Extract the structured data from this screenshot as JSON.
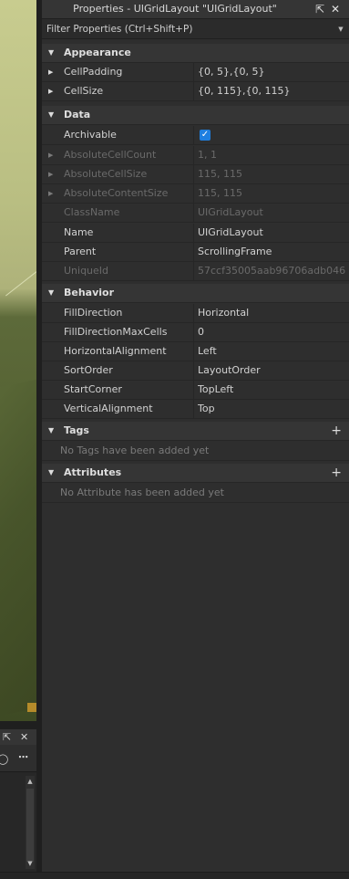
{
  "panel": {
    "title": "Properties - UIGridLayout \"UIGridLayout\"",
    "filter_placeholder": "Filter Properties (Ctrl+Shift+P)"
  },
  "sections": {
    "appearance": "Appearance",
    "data": "Data",
    "behavior": "Behavior",
    "tags": "Tags",
    "attributes": "Attributes"
  },
  "appearance": [
    {
      "name": "CellPadding",
      "value": "{0, 5},{0, 5}"
    },
    {
      "name": "CellSize",
      "value": "{0, 115},{0, 115}"
    }
  ],
  "data": {
    "archivable": {
      "name": "Archivable",
      "checked": true
    },
    "absolute_cell_count": {
      "name": "AbsoluteCellCount",
      "value": "1, 1"
    },
    "absolute_cell_size": {
      "name": "AbsoluteCellSize",
      "value": "115, 115"
    },
    "absolute_content_size": {
      "name": "AbsoluteContentSize",
      "value": "115, 115"
    },
    "class_name": {
      "name": "ClassName",
      "value": "UIGridLayout"
    },
    "name": {
      "name": "Name",
      "value": "UIGridLayout"
    },
    "parent": {
      "name": "Parent",
      "value": "ScrollingFrame"
    },
    "unique_id": {
      "name": "UniqueId",
      "value": "57ccf35005aab96706adb046..."
    }
  },
  "behavior": [
    {
      "name": "FillDirection",
      "value": "Horizontal"
    },
    {
      "name": "FillDirectionMaxCells",
      "value": "0"
    },
    {
      "name": "HorizontalAlignment",
      "value": "Left"
    },
    {
      "name": "SortOrder",
      "value": "LayoutOrder"
    },
    {
      "name": "StartCorner",
      "value": "TopLeft"
    },
    {
      "name": "VerticalAlignment",
      "value": "Top"
    }
  ],
  "tags_empty": "No Tags have been added yet",
  "attributes_empty": "No Attribute has been added yet",
  "colors": {
    "panel_bg": "#2e2e2e",
    "header_bg": "#353535",
    "checkbox_accent": "#1e7fe0",
    "disabled_text": "#6a6a6a"
  },
  "icons": [
    "undock-icon",
    "close-icon",
    "chevron-down-icon",
    "collapse-arrow-icon",
    "expand-arrow-icon",
    "plus-icon",
    "checkmark-icon",
    "more-icon"
  ]
}
